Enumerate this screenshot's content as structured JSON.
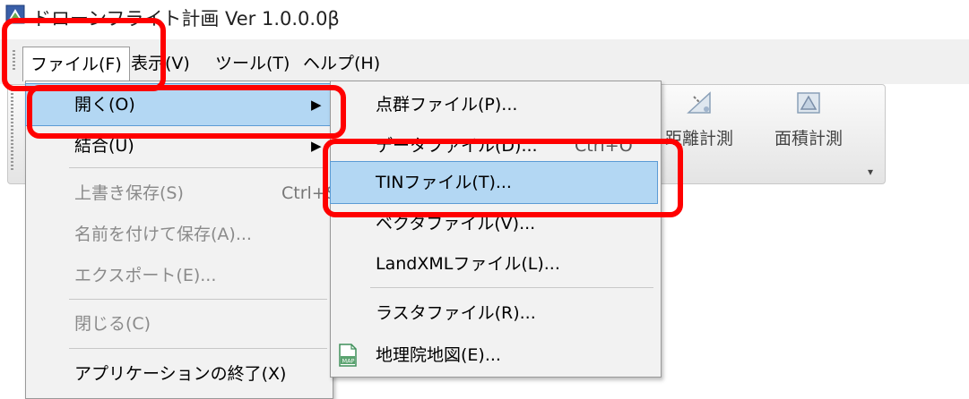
{
  "window": {
    "title": "ドローンフライト計画  Ver 1.0.0.0β"
  },
  "menubar": {
    "items": [
      {
        "label": "ファイル(F)"
      },
      {
        "label": "表示(V)"
      },
      {
        "label": "ツール(T)"
      },
      {
        "label": "ヘルプ(H)"
      }
    ]
  },
  "toolbar": {
    "buttons": [
      {
        "label": "距離計測",
        "icon": "distance-measure-icon"
      },
      {
        "label": "面積計測",
        "icon": "area-measure-icon"
      }
    ]
  },
  "file_menu": {
    "items": [
      {
        "label": "開く(O)",
        "has_submenu": true
      },
      {
        "label": "結合(U)",
        "has_submenu": true
      },
      {
        "label": "上書き保存(S)",
        "shortcut": "Ctrl+S",
        "disabled": true
      },
      {
        "label": "名前を付けて保存(A)...",
        "disabled": true
      },
      {
        "label": "エクスポート(E)...",
        "disabled": true
      },
      {
        "label": "閉じる(C)",
        "disabled": true
      },
      {
        "label": "アプリケーションの終了(X)"
      }
    ]
  },
  "open_submenu": {
    "items": [
      {
        "label": "点群ファイル(P)..."
      },
      {
        "label": "データファイル(D)...",
        "shortcut": "Ctrl+O"
      },
      {
        "label": "TINファイル(T)..."
      },
      {
        "label": "ベクタファイル(V)..."
      },
      {
        "label": "LandXMLファイル(L)..."
      },
      {
        "label": "ラスタファイル(R)..."
      },
      {
        "label": "地理院地図(E)...",
        "icon": "map-icon"
      }
    ]
  },
  "colors": {
    "highlight": "#b3d7f3",
    "annotation": "#ff0000",
    "menubar": "#f0f0f0"
  }
}
